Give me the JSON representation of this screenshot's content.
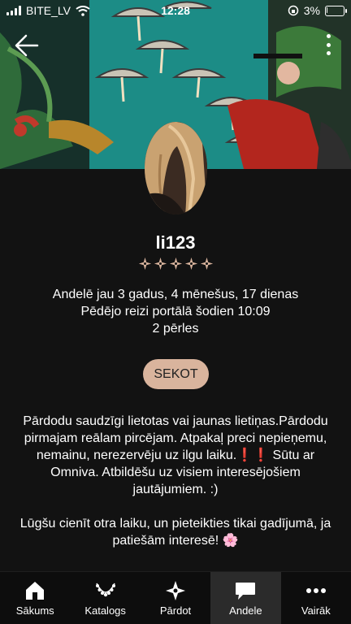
{
  "status": {
    "carrier": "BITE_LV",
    "time": "12:28",
    "battery": "3%",
    "battery_level": 0.03
  },
  "profile": {
    "username": "li123",
    "rating_stars": 5,
    "member_for": "Andelē jau 3 gadus, 4 mēnešus, 17 dienas",
    "last_seen": "Pēdējo reizi portālā šodien 10:09",
    "pearls": "2 pērles"
  },
  "actions": {
    "follow_label": "SEKOT"
  },
  "bio": {
    "paragraph1": "Pārdodu saudzīgi lietotas vai jaunas lietiņas.Pārdodu pirmajam reālam pircējam. Atpakaļ preci nepieņemu, nemainu, nerezervēju uz ilgu laiku.❗❗ Sūtu ar Omniva. Atbildēšu uz visiem interesējošiem jautājumiem. :)",
    "paragraph2": "Lūgšu cienīt otra laiku, un pieteikties tikai gadījumā, ja patiešām interesē! 🌸"
  },
  "tabs": [
    {
      "label": "Sākums",
      "icon": "home-icon",
      "active": false
    },
    {
      "label": "Katalogs",
      "icon": "necklace-icon",
      "active": false
    },
    {
      "label": "Pārdot",
      "icon": "sparkle-icon",
      "active": false
    },
    {
      "label": "Andele",
      "icon": "chat-icon",
      "active": true
    },
    {
      "label": "Vairāk",
      "icon": "more-dots-icon",
      "active": false
    }
  ],
  "colors": {
    "background": "#121212",
    "accent": "#d9b49d",
    "tab_active": "#2b2b2b",
    "cover_teal": "#1c8c86"
  }
}
